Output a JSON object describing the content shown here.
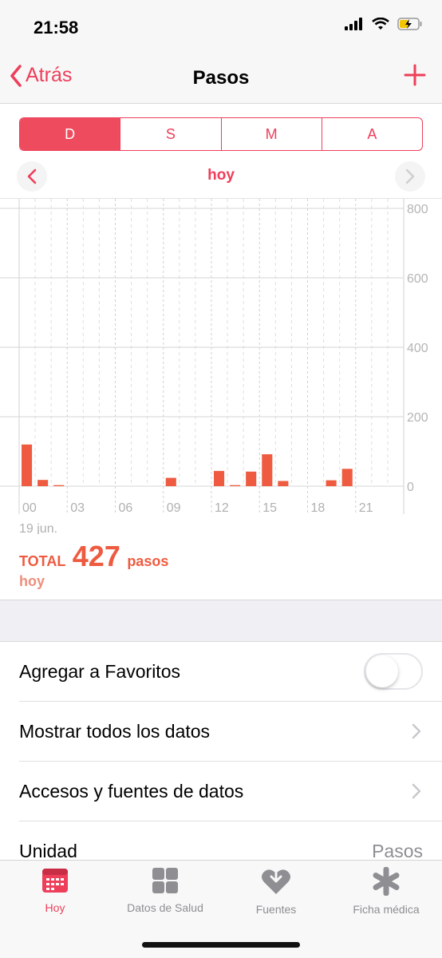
{
  "status": {
    "time": "21:58"
  },
  "nav": {
    "back_label": "Atrás",
    "title": "Pasos"
  },
  "segments": [
    "D",
    "S",
    "M",
    "A"
  ],
  "date_label": "hoy",
  "chart_data": {
    "type": "bar",
    "x_ticks": [
      "00",
      "03",
      "06",
      "09",
      "12",
      "15",
      "18",
      "21"
    ],
    "y_ticks": [
      "800",
      "600",
      "400",
      "200",
      "0"
    ],
    "ylim": [
      0,
      800
    ],
    "date_caption": "19 jun.",
    "categories": [
      0,
      1,
      2,
      3,
      4,
      5,
      6,
      7,
      8,
      9,
      10,
      11,
      12,
      13,
      14,
      15,
      16,
      17,
      18,
      19,
      20,
      21,
      22,
      23
    ],
    "values": [
      120,
      18,
      3,
      0,
      0,
      0,
      0,
      0,
      0,
      24,
      0,
      0,
      44,
      3,
      42,
      92,
      15,
      0,
      0,
      17,
      50,
      0,
      0,
      0
    ],
    "bar_color": "#ee5b40"
  },
  "total": {
    "label": "TOTAL",
    "value": "427",
    "unit": "pasos",
    "period": "hoy"
  },
  "list": {
    "favorites": "Agregar a Favoritos",
    "show_all": "Mostrar todos los datos",
    "access": "Accesos y fuentes de datos",
    "unit_label": "Unidad",
    "unit_value": "Pasos"
  },
  "tabs": [
    {
      "label": "Hoy",
      "icon": "calendar-icon"
    },
    {
      "label": "Datos de Salud",
      "icon": "grid-icon"
    },
    {
      "label": "Fuentes",
      "icon": "heart-arrow-icon"
    },
    {
      "label": "Ficha médica",
      "icon": "asterisk-icon"
    }
  ],
  "colors": {
    "accent": "#ee3e5a",
    "bar": "#ee5b40"
  }
}
